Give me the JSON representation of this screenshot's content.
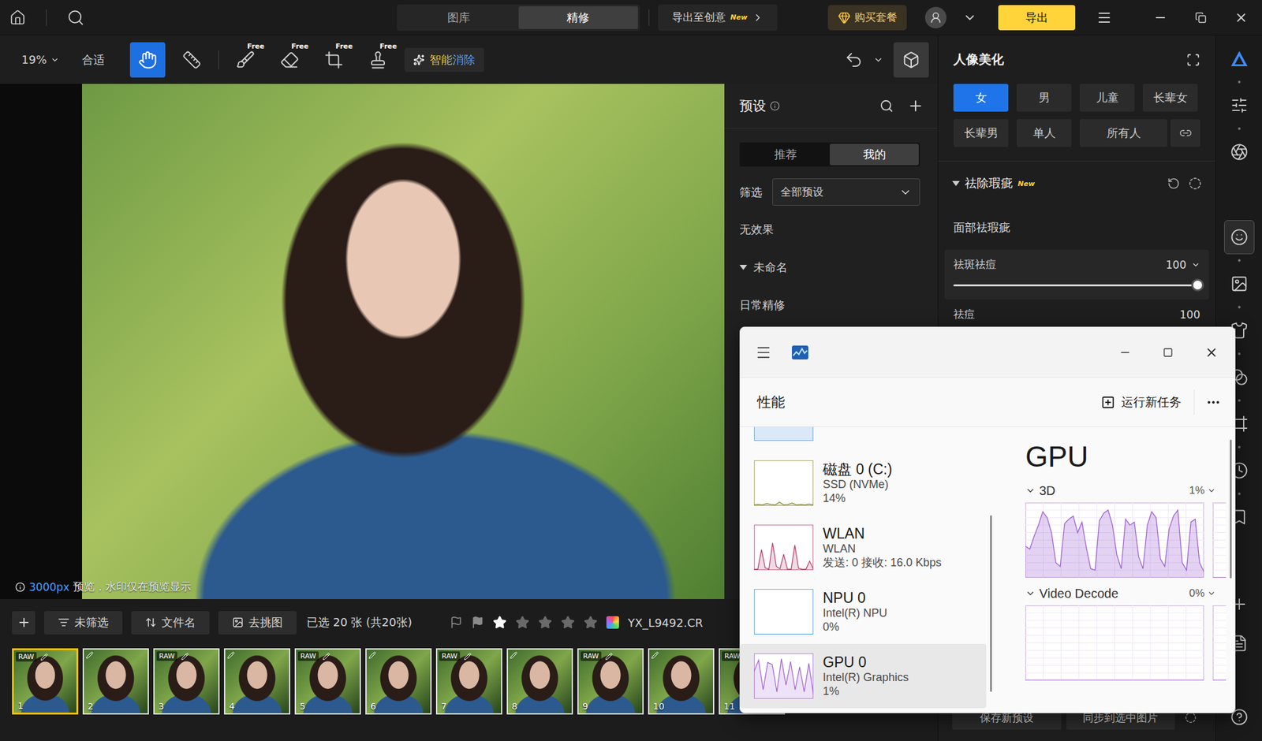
{
  "topbar": {
    "tabs": [
      {
        "label": "图库",
        "selected": false
      },
      {
        "label": "精修",
        "selected": true
      }
    ],
    "export_to": {
      "label": "导出至创意",
      "badge": "New"
    },
    "buy": "购买套餐",
    "export": "导出"
  },
  "toolbar": {
    "zoom": "19%",
    "fit": "合适",
    "tools": [
      {
        "kind": "hand",
        "badge": "",
        "selected": true
      },
      {
        "kind": "straighten",
        "badge": "",
        "selected": false
      },
      {
        "kind": "brush",
        "badge": "Free",
        "selected": false
      },
      {
        "kind": "eraser",
        "badge": "Free",
        "selected": false
      },
      {
        "kind": "crop",
        "badge": "Free",
        "selected": false
      },
      {
        "kind": "stamp",
        "badge": "Free",
        "selected": false
      }
    ],
    "smart_erase": "智能消除"
  },
  "canvas": {
    "preview_size": "3000px",
    "preview_note": "预览，水印仅在预览显示"
  },
  "presets": {
    "title": "预设",
    "tabs": [
      {
        "label": "推荐",
        "selected": false
      },
      {
        "label": "我的",
        "selected": true
      }
    ],
    "filter_label": "筛选",
    "filter_value": "全部预设",
    "items": [
      {
        "label": "无效果",
        "kind": "item",
        "expanded": false
      },
      {
        "label": "未命名",
        "kind": "group",
        "expanded": true
      },
      {
        "label": "日常精修",
        "kind": "item",
        "expanded": false
      }
    ]
  },
  "beauty": {
    "title": "人像美化",
    "targets": [
      {
        "label": "女",
        "selected": true
      },
      {
        "label": "男",
        "selected": false
      },
      {
        "label": "儿童",
        "selected": false
      },
      {
        "label": "长辈女",
        "selected": false
      },
      {
        "label": "长辈男",
        "selected": false
      },
      {
        "label": "单人",
        "selected": false
      },
      {
        "label": "所有人",
        "selected": false
      }
    ],
    "section": {
      "title": "祛除瑕疵",
      "badge": "New",
      "expanded": true
    },
    "subsection": "面部祛瑕疵",
    "sliders": [
      {
        "label": "祛斑祛痘",
        "value": "100",
        "level": 1,
        "focused": true
      },
      {
        "label": "祛痘",
        "value": "100",
        "level": 1,
        "focused": false
      }
    ],
    "footer": [
      "保存新预设",
      "同步到选中图片"
    ]
  },
  "sidebar": {
    "groups": [
      [
        {
          "kind": "logo",
          "selected": false
        },
        {
          "kind": "adjust",
          "selected": false
        },
        {
          "kind": "texture",
          "selected": false
        }
      ],
      [
        {
          "kind": "face",
          "selected": true
        },
        {
          "kind": "image",
          "selected": false
        },
        {
          "kind": "clothes",
          "selected": false
        },
        {
          "kind": "blend",
          "selected": false
        },
        {
          "kind": "frame",
          "selected": false
        },
        {
          "kind": "history",
          "selected": false
        },
        {
          "kind": "stamp",
          "selected": false
        }
      ],
      [
        {
          "kind": "add",
          "selected": false
        },
        {
          "kind": "notes",
          "selected": false
        }
      ],
      [
        {
          "kind": "help",
          "selected": false
        }
      ]
    ]
  },
  "filmstrip": {
    "filter": "未筛选",
    "sort": "文件名",
    "cull": "去挑图",
    "count": "已选 20 张 (共20张)",
    "stars": 1,
    "filename": "YX_L9492.CR",
    "raw_label": "RAW",
    "thumbs": [
      {
        "number": "1",
        "raw": true,
        "edited": true,
        "selected": true
      },
      {
        "number": "2",
        "raw": false,
        "edited": true,
        "selected": false
      },
      {
        "number": "3",
        "raw": true,
        "edited": true,
        "selected": false
      },
      {
        "number": "4",
        "raw": false,
        "edited": true,
        "selected": false
      },
      {
        "number": "5",
        "raw": true,
        "edited": true,
        "selected": false
      },
      {
        "number": "6",
        "raw": false,
        "edited": true,
        "selected": false
      },
      {
        "number": "7",
        "raw": true,
        "edited": true,
        "selected": false
      },
      {
        "number": "8",
        "raw": false,
        "edited": true,
        "selected": false
      },
      {
        "number": "9",
        "raw": true,
        "edited": true,
        "selected": false
      },
      {
        "number": "10",
        "raw": false,
        "edited": true,
        "selected": false
      },
      {
        "number": "11",
        "raw": true,
        "edited": true,
        "selected": false
      }
    ]
  },
  "task_manager": {
    "section": "性能",
    "run_task": "运行新任务",
    "devices": [
      {
        "name": "磁盘 0 (C:)",
        "lines": [
          "SSD (NVMe)",
          "14%"
        ],
        "selected": false,
        "color": "#8a8a3c",
        "values": [
          2,
          3,
          2,
          5,
          3,
          2,
          8,
          2,
          3,
          6,
          2,
          3,
          2,
          4,
          2
        ]
      },
      {
        "name": "WLAN",
        "lines": [
          "WLAN",
          "发送: 0 接收: 16.0 Kbps"
        ],
        "selected": false,
        "color": "#b03a64",
        "values": [
          2,
          2,
          45,
          5,
          2,
          60,
          8,
          3,
          35,
          2,
          2,
          55,
          4,
          2,
          2,
          20,
          2
        ]
      },
      {
        "name": "NPU 0",
        "lines": [
          "Intel(R) NPU",
          "0%"
        ],
        "selected": false,
        "color": "#2a8bd6",
        "values": [
          0,
          0,
          0,
          0,
          0,
          0
        ]
      },
      {
        "name": "GPU 0",
        "lines": [
          "Intel(R) Graphics",
          "1%"
        ],
        "selected": true,
        "color": "#9c5fd2",
        "values": [
          60,
          85,
          20,
          80,
          75,
          15,
          88,
          30,
          82,
          20,
          70,
          15,
          78,
          10
        ]
      }
    ],
    "detail": {
      "title": "GPU",
      "graphs": [
        {
          "label": "3D",
          "reading": "1%",
          "values": [
            42,
            38,
            55,
            70,
            88,
            80,
            60,
            20,
            15,
            72,
            78,
            82,
            60,
            74,
            40,
            12,
            10,
            76,
            86,
            90,
            70,
            30,
            12,
            78,
            70,
            74,
            28,
            12,
            70,
            88,
            80,
            25,
            15,
            65,
            82,
            90,
            20,
            10,
            74,
            78,
            20,
            8
          ]
        },
        {
          "label": "Video Decode",
          "reading": "0%",
          "values": [
            0,
            0,
            0,
            0,
            0,
            0,
            0,
            0,
            0,
            0,
            0,
            0
          ]
        }
      ]
    }
  }
}
